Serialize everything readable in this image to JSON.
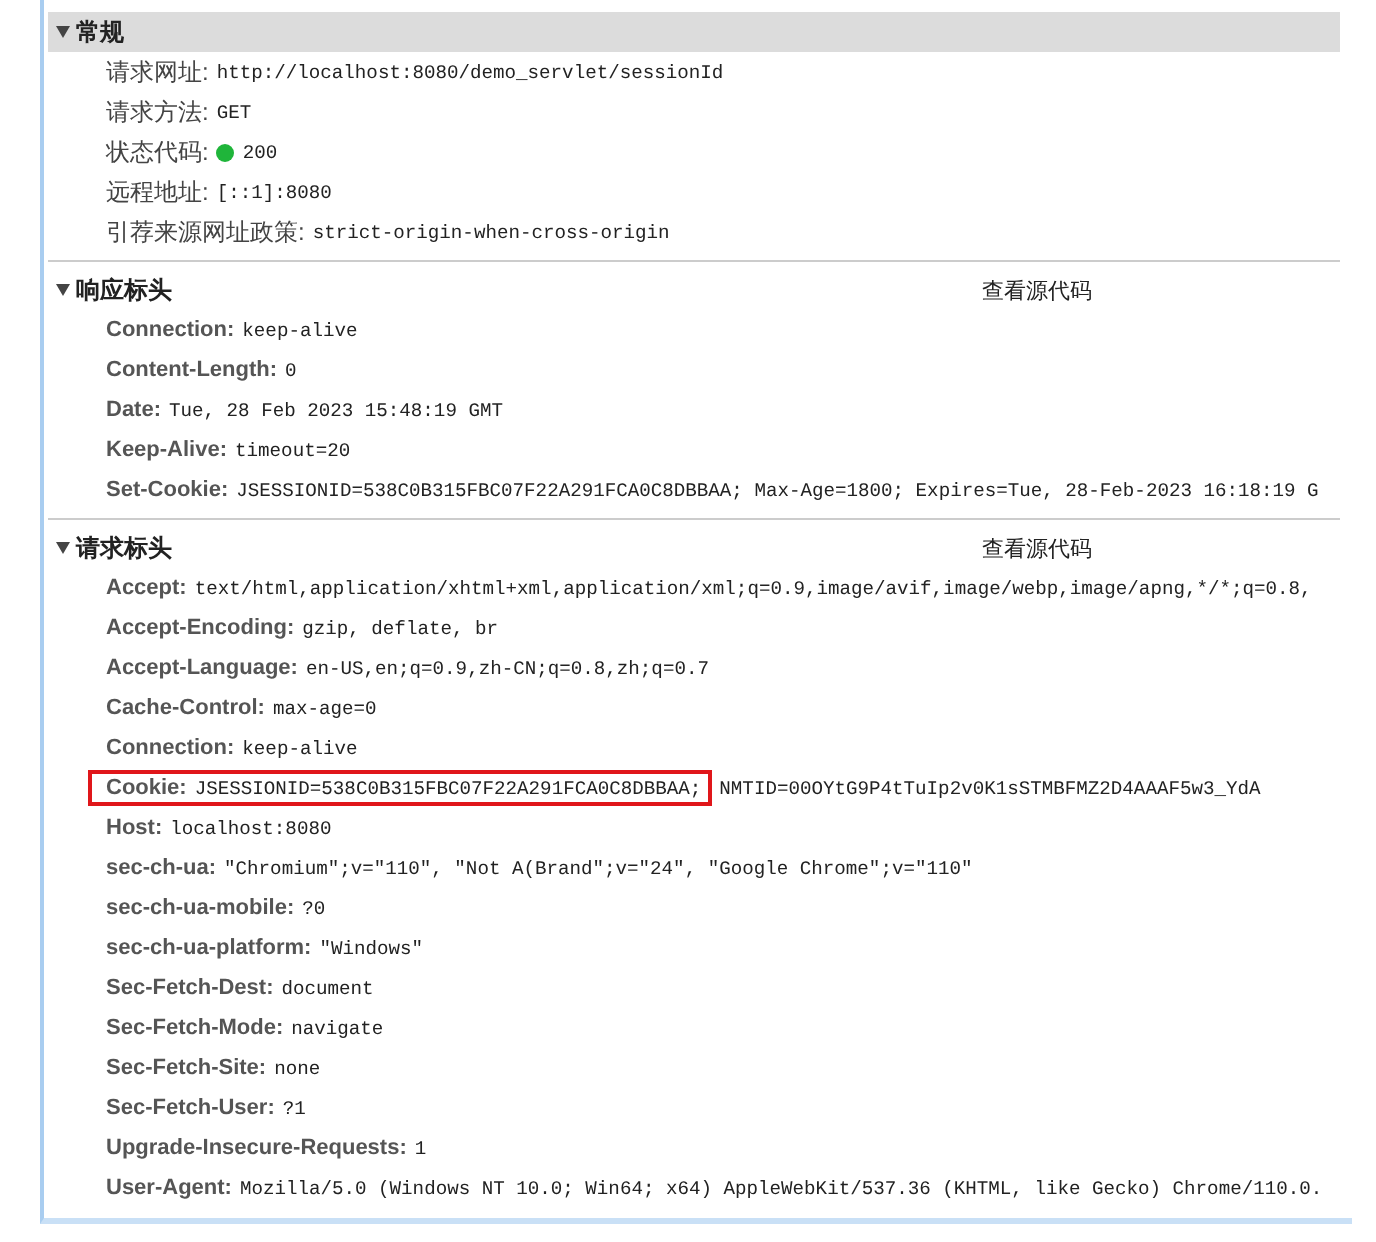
{
  "sections": [
    {
      "title": "常规",
      "shaded": true,
      "rows": [
        {
          "name": "请求网址:",
          "value": "http://localhost:8080/demo_servlet/sessionId",
          "highlighted": false
        },
        {
          "name": "请求方法:",
          "value": "GET",
          "highlighted": false
        },
        {
          "name": "状态代码:",
          "value": "200",
          "color": "#1fb53a",
          "highlighted": false
        },
        {
          "name": "远程地址:",
          "value": "[::1]:8080",
          "highlighted": false
        },
        {
          "name": "引荐来源网址政策:",
          "value": "strict-origin-when-cross-origin",
          "highlighted": false
        }
      ]
    },
    {
      "title": "响应标头",
      "shaded": false,
      "link": "查看源代码",
      "rows": [
        {
          "name": "Connection:",
          "value": "keep-alive",
          "highlighted": false
        },
        {
          "name": "Content-Length:",
          "value": "0",
          "highlighted": false
        },
        {
          "name": "Date:",
          "value": "Tue, 28 Feb 2023 15:48:19 GMT",
          "highlighted": false
        },
        {
          "name": "Keep-Alive:",
          "value": "timeout=20",
          "highlighted": false
        },
        {
          "name": "Set-Cookie:",
          "value": "JSESSIONID=538C0B315FBC07F22A291FCA0C8DBBAA; Max-Age=1800; Expires=Tue, 28-Feb-2023 16:18:19 G",
          "highlighted": false
        }
      ]
    },
    {
      "title": "请求标头",
      "shaded": false,
      "link": "查看源代码",
      "rows": [
        {
          "name": "Accept:",
          "value": "text/html,application/xhtml+xml,application/xml;q=0.9,image/avif,image/webp,image/apng,*/*;q=0.8,",
          "highlighted": false
        },
        {
          "name": "Accept-Encoding:",
          "value": "gzip, deflate, br",
          "highlighted": false
        },
        {
          "name": "Accept-Language:",
          "value": "en-US,en;q=0.9,zh-CN;q=0.8,zh;q=0.7",
          "highlighted": false
        },
        {
          "name": "Cache-Control:",
          "value": "max-age=0",
          "highlighted": false
        },
        {
          "name": "Connection:",
          "value": "keep-alive",
          "highlighted": false
        },
        {
          "name": "Cookie:",
          "value": "JSESSIONID=538C0B315FBC07F22A291FCA0C8DBBAA;",
          "value_after": "NMTID=00OYtG9P4tTuIp2v0K1sSTMBFMZ2D4AAAF5w3_YdA",
          "highlighted": true
        },
        {
          "name": "Host:",
          "value": "localhost:8080",
          "highlighted": false
        },
        {
          "name": "sec-ch-ua:",
          "value": "\"Chromium\";v=\"110\", \"Not A(Brand\";v=\"24\", \"Google Chrome\";v=\"110\"",
          "highlighted": false
        },
        {
          "name": "sec-ch-ua-mobile:",
          "value": "?0",
          "highlighted": false
        },
        {
          "name": "sec-ch-ua-platform:",
          "value": "\"Windows\"",
          "highlighted": false
        },
        {
          "name": "Sec-Fetch-Dest:",
          "value": "document",
          "highlighted": false
        },
        {
          "name": "Sec-Fetch-Mode:",
          "value": "navigate",
          "highlighted": false
        },
        {
          "name": "Sec-Fetch-Site:",
          "value": "none",
          "highlighted": false
        },
        {
          "name": "Sec-Fetch-User:",
          "value": "?1",
          "highlighted": false
        },
        {
          "name": "Upgrade-Insecure-Requests:",
          "value": "1",
          "highlighted": false
        },
        {
          "name": "User-Agent:",
          "value": "Mozilla/5.0 (Windows NT 10.0; Win64; x64) AppleWebKit/537.36 (KHTML, like Gecko) Chrome/110.0.",
          "highlighted": false
        }
      ]
    }
  ]
}
